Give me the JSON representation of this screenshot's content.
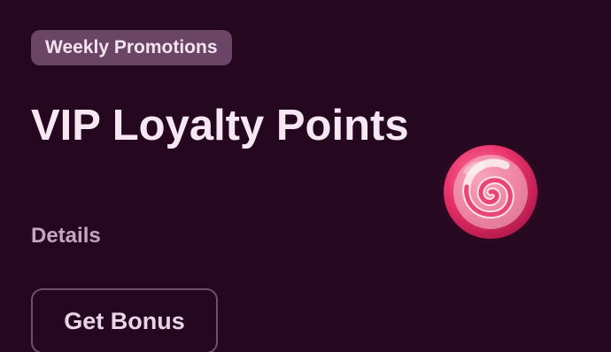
{
  "promo": {
    "badge": "Weekly Promotions",
    "title": "VIP Loyalty Points",
    "details_link": "Details",
    "cta_label": "Get Bonus"
  },
  "colors": {
    "background": "#25081f",
    "badge_bg": "#6a4565",
    "title_text": "#f6e7f3",
    "candy_primary": "#e8336c",
    "candy_light": "#f7d8df"
  },
  "icons": {
    "illustration": "swirl-candy-icon"
  }
}
